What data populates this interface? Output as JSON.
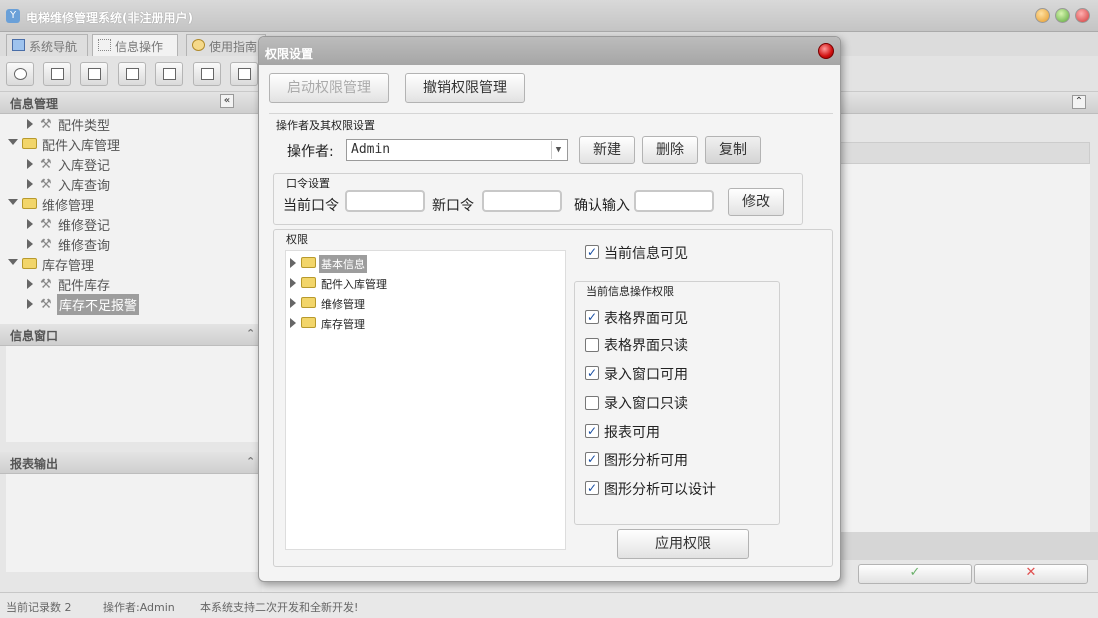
{
  "app": {
    "title": "电梯维修管理系统(非注册用户)"
  },
  "tabs": [
    {
      "label": "系统导航"
    },
    {
      "label": "信息操作"
    },
    {
      "label": "使用指南"
    }
  ],
  "left_panel": {
    "info_mgmt_title": "信息管理",
    "tree": [
      {
        "label": "配件类型"
      },
      {
        "label": "配件入库管理"
      },
      {
        "label": "入库登记"
      },
      {
        "label": "入库查询"
      },
      {
        "label": "维修管理"
      },
      {
        "label": "维修登记"
      },
      {
        "label": "维修查询"
      },
      {
        "label": "库存管理"
      },
      {
        "label": "配件库存"
      },
      {
        "label": "库存不足报警"
      }
    ],
    "info_window_title": "信息窗口",
    "report_title": "报表输出"
  },
  "status": {
    "records": "当前记录数 2",
    "operator": "操作者:Admin",
    "note": "本系统支持二次开发和全新开发!"
  },
  "dialog": {
    "title": "权限设置",
    "enable_btn": "启动权限管理",
    "revoke_btn": "撤销权限管理",
    "operator_section": "操作者及其权限设置",
    "operator_label": "操作者:",
    "operator_value": "Admin",
    "new_btn": "新建",
    "delete_btn": "删除",
    "copy_btn": "复制",
    "pwd_section": "口令设置",
    "current_pwd": "当前口令",
    "new_pwd": "新口令",
    "confirm_pwd": "确认输入",
    "modify_btn": "修改",
    "perm_section": "权限",
    "perm_tree": [
      {
        "label": "基本信息"
      },
      {
        "label": "配件入库管理"
      },
      {
        "label": "维修管理"
      },
      {
        "label": "库存管理"
      }
    ],
    "visible_label": "当前信息可见",
    "visible_checked": true,
    "ops_section": "当前信息操作权限",
    "ops": [
      {
        "label": "表格界面可见",
        "checked": true
      },
      {
        "label": "表格界面只读",
        "checked": false
      },
      {
        "label": "录入窗口可用",
        "checked": true
      },
      {
        "label": "录入窗口只读",
        "checked": false
      },
      {
        "label": "报表可用",
        "checked": true
      },
      {
        "label": "图形分析可用",
        "checked": true
      },
      {
        "label": "图形分析可以设计",
        "checked": true
      }
    ],
    "apply_btn": "应用权限"
  },
  "bg_buttons": {
    "confirm": "✓",
    "cancel": "✕"
  },
  "colors": {
    "accent": "#1a4fa3",
    "selected_bg": "#9d9d9d",
    "close_red": "#d01010"
  }
}
